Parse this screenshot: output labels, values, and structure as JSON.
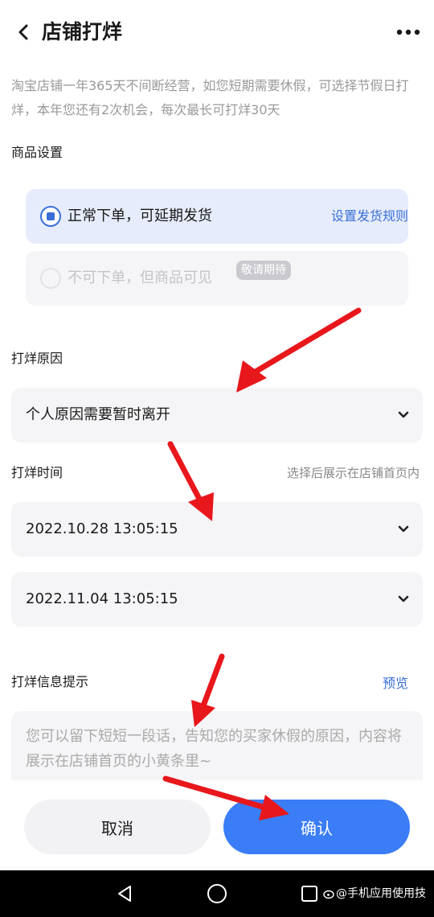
{
  "header": {
    "title": "店铺打烊",
    "back_icon": "chevron-left-icon",
    "more_icon": "more-dots-icon"
  },
  "intro": "淘宝店铺一年365天不间断经营，如您短期需要休假，可选择节假日打烊，本年您还有2次机会，每次最长可打烊30天",
  "product_settings": {
    "label": "商品设置",
    "options": [
      {
        "label": "正常下单，可延期发货",
        "selected": true,
        "link": "设置发货规则"
      },
      {
        "label": "不可下单，但商品可见",
        "selected": false,
        "disabled": true,
        "badge": "敬请期待"
      }
    ]
  },
  "reason": {
    "label": "打烊原因",
    "value": "个人原因需要暂时离开"
  },
  "time": {
    "label": "打烊时间",
    "hint": "选择后展示在店铺首页内",
    "start": "2022.10.28 13:05:15",
    "end": "2022.11.04 13:05:15"
  },
  "message": {
    "label": "打烊信息提示",
    "preview_link": "预览",
    "placeholder": "您可以留下短短一段话，告知您的买家休假的原因，内容将展示在店铺首页的小黄条里~"
  },
  "footer": {
    "cancel_label": "取消",
    "confirm_label": "确认"
  },
  "system_nav": {
    "watermark": "@手机应用使用技"
  },
  "colors": {
    "accent": "#3a7df6",
    "link": "#3a6fd8",
    "selected_bg": "#e6ecfb",
    "field_bg": "#f5f5f7",
    "annotation_arrow": "#e8171c"
  }
}
